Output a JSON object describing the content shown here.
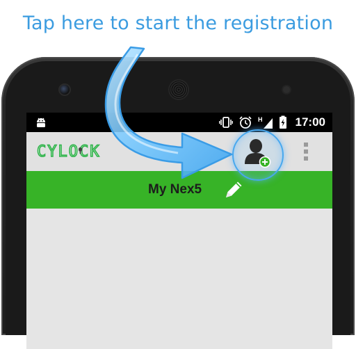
{
  "overlay": {
    "instruction": "Tap here to start the registration"
  },
  "status_bar": {
    "time": "17:00",
    "icons": [
      "android-icon",
      "vibrate-icon",
      "alarm-icon",
      "signal-h-icon",
      "battery-charging-icon"
    ]
  },
  "toolbar": {
    "logo_text": "CYLOCK",
    "register_icon": "add-user-icon",
    "overflow_icon": "overflow-menu-icon"
  },
  "device": {
    "name": "My Nex5",
    "edit_icon": "pencil-icon"
  },
  "colors": {
    "caption": "#3b9ce0",
    "accent_green": "#37b327",
    "logo_green": "#2fb34a",
    "toolbar": "#e1e1e1",
    "highlight_blue": "#48a8ee"
  }
}
